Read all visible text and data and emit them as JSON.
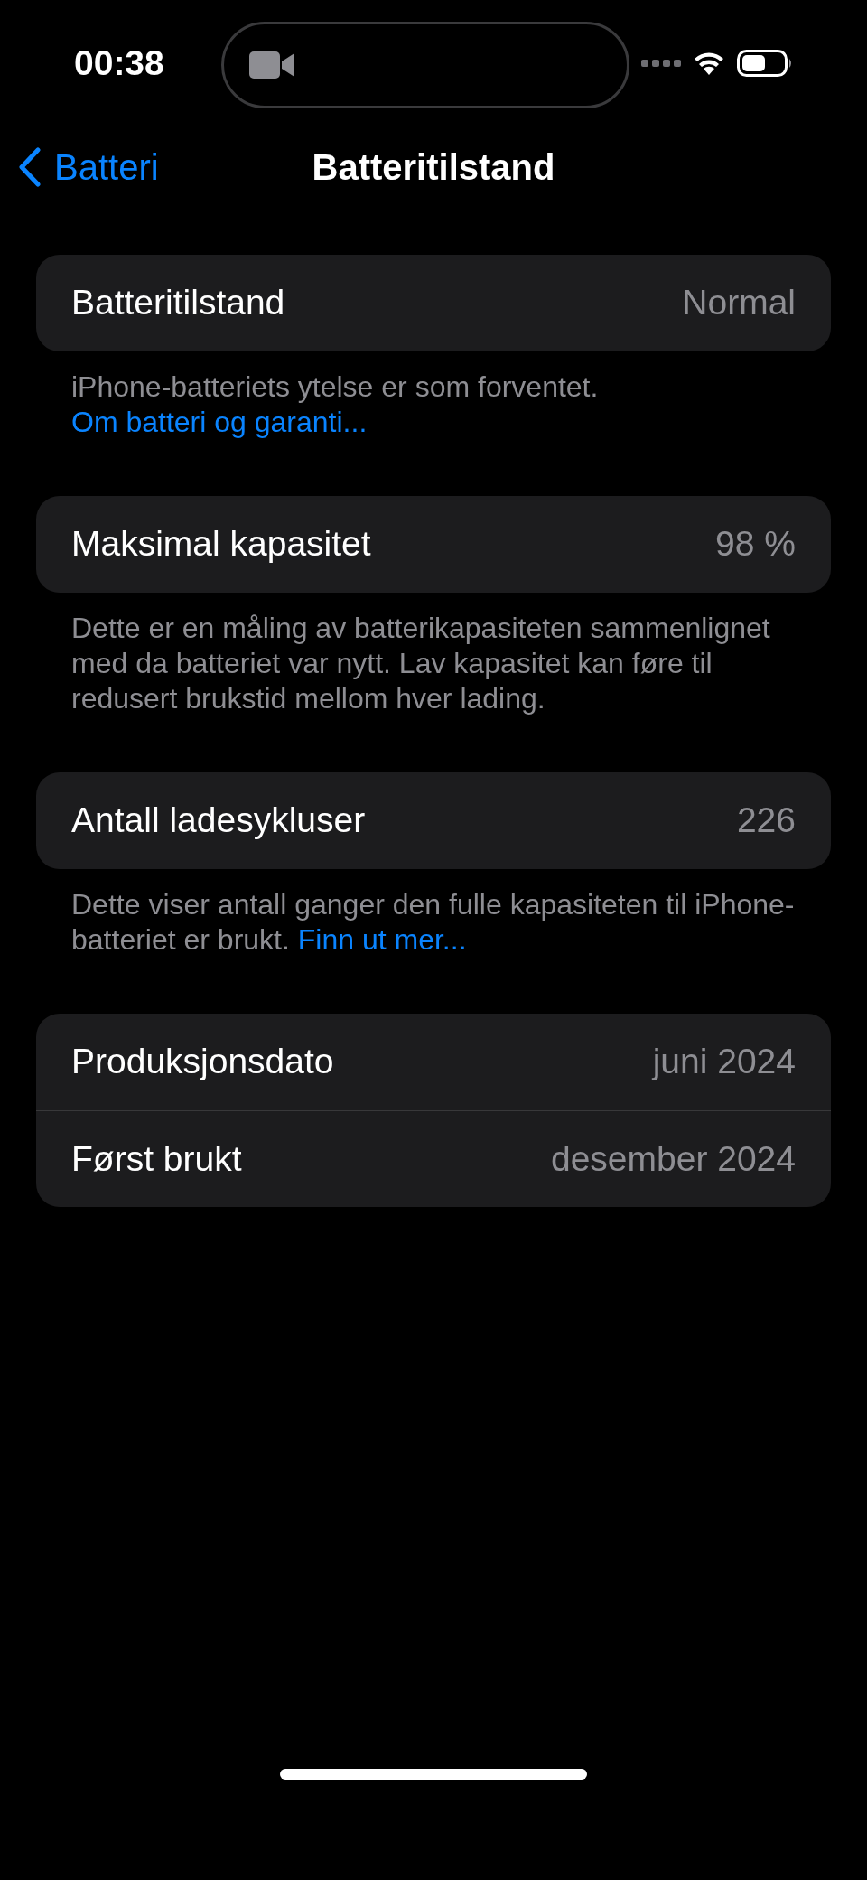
{
  "status_bar": {
    "time": "00:38"
  },
  "nav": {
    "back": "Batteri",
    "title": "Batteritilstand"
  },
  "sections": [
    {
      "rows": [
        {
          "label": "Batteritilstand",
          "value": "Normal"
        }
      ],
      "footer": {
        "text": "iPhone-batteriets ytelse er som forventet.",
        "link": "Om batteri og garanti..."
      }
    },
    {
      "rows": [
        {
          "label": "Maksimal kapasitet",
          "value": "98 %"
        }
      ],
      "footer": {
        "text": "Dette er en måling av batterikapasiteten sammenlignet med da batteriet var nytt. Lav kapasitet kan føre til redusert brukstid mellom hver lading."
      }
    },
    {
      "rows": [
        {
          "label": "Antall ladesykluser",
          "value": "226"
        }
      ],
      "footer": {
        "text": "Dette viser antall ganger den fulle kapasiteten til iPhone-batteriet er brukt.",
        "link": "Finn ut mer..."
      }
    },
    {
      "rows": [
        {
          "label": "Produksjonsdato",
          "value": "juni 2024"
        },
        {
          "label": "Først brukt",
          "value": "desember 2024"
        }
      ]
    }
  ]
}
